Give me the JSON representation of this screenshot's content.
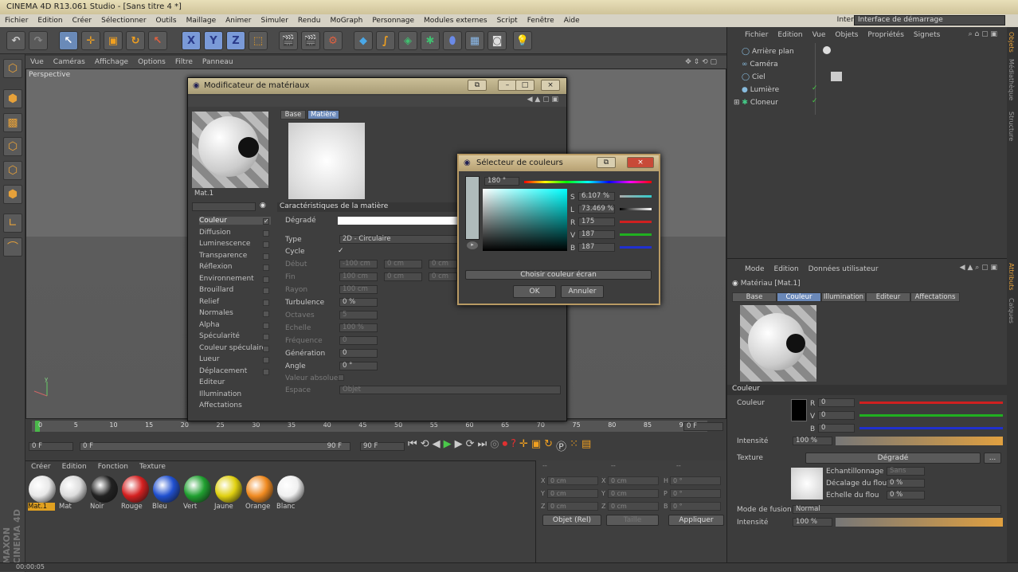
{
  "window": {
    "title": "CINEMA 4D R13.061 Studio - [Sans titre 4 *]"
  },
  "menu": [
    "Fichier",
    "Edition",
    "Créer",
    "Sélectionner",
    "Outils",
    "Maillage",
    "Animer",
    "Simuler",
    "Rendu",
    "MoGraph",
    "Personnage",
    "Modules externes",
    "Script",
    "Fenêtre",
    "Aide"
  ],
  "interface": {
    "label": "Interface:",
    "value": "Interface de démarrage"
  },
  "viewport": {
    "menu": [
      "Vue",
      "Caméras",
      "Affichage",
      "Options",
      "Filtre",
      "Panneau"
    ],
    "label": "Perspective",
    "axis_y": "y"
  },
  "timeline": {
    "ticks": [
      "0",
      "5",
      "10",
      "15",
      "20",
      "25",
      "30",
      "35",
      "40",
      "45",
      "50",
      "55",
      "60",
      "65",
      "70",
      "75",
      "80",
      "85",
      "90"
    ],
    "current": "0 F",
    "start": "0 F",
    "range_start": "0 F",
    "range_end": "90 F",
    "end": "90 F",
    "right_field": "0 F"
  },
  "materials": {
    "menu": [
      "Créer",
      "Edition",
      "Fonction",
      "Texture"
    ],
    "items": [
      {
        "label": "Mat.1",
        "color": "#e8e8e8"
      },
      {
        "label": "Mat",
        "color": "#dcdcdc"
      },
      {
        "label": "Noir",
        "color": "#222222"
      },
      {
        "label": "Rouge",
        "color": "#d42020"
      },
      {
        "label": "Bleu",
        "color": "#2050d0"
      },
      {
        "label": "Vert",
        "color": "#20a030"
      },
      {
        "label": "Jaune",
        "color": "#e0d010"
      },
      {
        "label": "Orange",
        "color": "#f08a20"
      },
      {
        "label": "Blanc",
        "color": "#f0f0f0"
      }
    ]
  },
  "coords": {
    "headers": [
      "--",
      "--",
      "--"
    ],
    "rows": [
      {
        "a": "X",
        "av": "0 cm",
        "b": "X",
        "bv": "0 cm",
        "c": "H",
        "cv": "0 °"
      },
      {
        "a": "Y",
        "av": "0 cm",
        "b": "Y",
        "bv": "0 cm",
        "c": "P",
        "cv": "0 °"
      },
      {
        "a": "Z",
        "av": "0 cm",
        "b": "Z",
        "bv": "0 cm",
        "c": "B",
        "cv": "0 °"
      }
    ],
    "mode": "Objet (Rel)",
    "size": "Taille",
    "apply": "Appliquer"
  },
  "status": {
    "time": "00:00:05"
  },
  "objects": {
    "menu": [
      "Fichier",
      "Edition",
      "Vue",
      "Objets",
      "Propriétés",
      "Signets"
    ],
    "items": [
      "Arrière plan",
      "Caméra",
      "Ciel",
      "Lumière",
      "Cloneur"
    ]
  },
  "attributes": {
    "menu": [
      "Mode",
      "Edition",
      "Données utilisateur"
    ],
    "title": "Matériau [Mat.1]",
    "tabs": [
      "Base",
      "Couleur",
      "Illumination",
      "Editeur",
      "Affectations"
    ],
    "section": "Couleur",
    "color_label": "Couleur",
    "r": "0",
    "g": "0",
    "b": "0",
    "intensity_label": "Intensité",
    "intensity": "100 %",
    "texture_label": "Texture",
    "texture_value": "Dégradé",
    "sampling_label": "Echantillonnage",
    "sampling_value": "Sans",
    "blur_offset_label": "Décalage du flou",
    "blur_offset": "0 %",
    "blur_scale_label": "Echelle du flou",
    "blur_scale": "0 %",
    "blend_label": "Mode de fusion",
    "blend_value": "Normal",
    "intensity2_label": "Intensité",
    "intensity2": "100 %"
  },
  "side_tabs": [
    "Objets",
    "Médiathèque",
    "Structure",
    "Attributs",
    "Calques"
  ],
  "mat_editor": {
    "title": "Modificateur de matériaux",
    "material_name": "Mat.1",
    "tabs": [
      "Base",
      "Matière"
    ],
    "channels": [
      "Couleur",
      "Diffusion",
      "Luminescence",
      "Transparence",
      "Réflexion",
      "Environnement",
      "Brouillard",
      "Relief",
      "Normales",
      "Alpha",
      "Spécularité",
      "Couleur spéculaire",
      "Lueur",
      "Déplacement",
      "Editeur",
      "Illumination",
      "Affectations"
    ],
    "section": "Caractéristiques de la matière",
    "props": {
      "gradient": "Dégradé",
      "type_label": "Type",
      "type_value": "2D - Circulaire",
      "cycle_label": "Cycle",
      "cycle_check": "✓",
      "start_label": "Début",
      "start_vals": [
        "-100 cm",
        "0 cm",
        "0 cm"
      ],
      "end_label": "Fin",
      "end_vals": [
        "100 cm",
        "0 cm",
        "0 cm"
      ],
      "radius_label": "Rayon",
      "radius_val": "100 cm",
      "turb_label": "Turbulence",
      "turb_val": "0 %",
      "octaves_label": "Octaves",
      "octaves_val": "5",
      "scale_label": "Echelle",
      "scale_val": "100 %",
      "freq_label": "Fréquence",
      "freq_val": "0",
      "gen_label": "Génération",
      "gen_val": "0",
      "angle_label": "Angle",
      "angle_val": "0 °",
      "absval_label": "Valeur absolue",
      "space_label": "Espace",
      "space_val": "Objet"
    }
  },
  "color_picker": {
    "title": "Sélecteur de couleurs",
    "hue": "180 °",
    "s_label": "S",
    "s": "6.107 %",
    "l_label": "L",
    "l": "73.469 %",
    "r_label": "R",
    "r": "175",
    "v_label": "V",
    "v": "187",
    "b_label": "B",
    "b": "187",
    "screen_pick": "Choisir couleur écran",
    "ok": "OK",
    "cancel": "Annuler"
  },
  "brand": "MAXON CINEMA 4D"
}
